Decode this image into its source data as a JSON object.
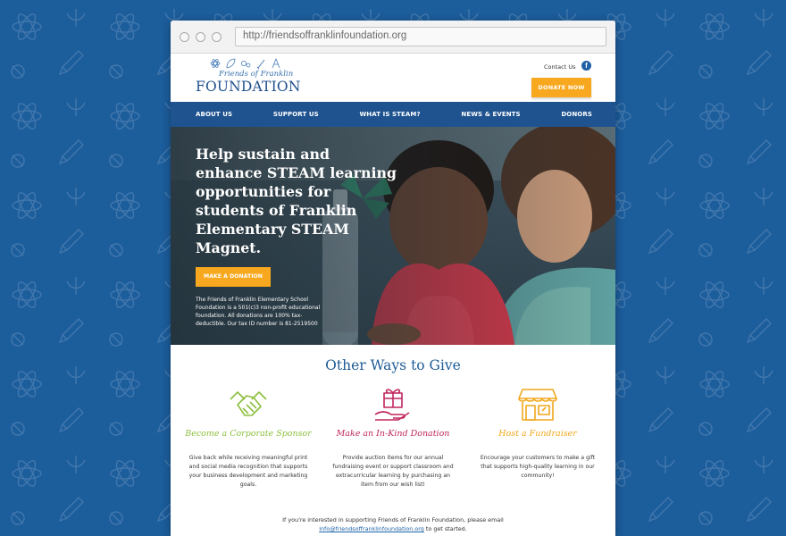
{
  "browser": {
    "url": "http://friendsoffranklinfoundation.org"
  },
  "logo": {
    "line1": "Friends of Franklin",
    "line2": "FOUNDATION"
  },
  "header": {
    "contact": "Contact Us",
    "facebook_glyph": "f",
    "donate": "DONATE NOW"
  },
  "nav": {
    "items": [
      "ABOUT US",
      "SUPPORT US",
      "WHAT IS STEAM?",
      "NEWS & EVENTS",
      "DONORS"
    ]
  },
  "hero": {
    "headline": "Help sustain and enhance STEAM learning opportunities for students of Franklin Elementary STEAM Magnet.",
    "button": "MAKE A DONATION",
    "text": "The Friends of Franklin Elementary School Foundation is a 501(c)3 non-profit educational foundation. All donations are 100% tax-deductible. Our tax ID number is 81-2519500"
  },
  "ways": {
    "title": "Other Ways to Give",
    "items": [
      {
        "title": "Become a Corporate Sponsor",
        "color": "#8dbf3f",
        "icon": "handshake-icon",
        "text": "Give back while receiving meaningful print and social media recognition that supports your business development and marketing goals."
      },
      {
        "title": "Make an In-Kind Donation",
        "color": "#c0265f",
        "icon": "gift-hand-icon",
        "text": "Provide auction items for our annual fundraising event or support classroom and extracurricular learning by purchasing an item from our wish list!"
      },
      {
        "title": "Host a Fundraiser",
        "color": "#f2a71c",
        "icon": "storefront-icon",
        "text": "Encourage your customers to make a gift that supports high-quality learning in our community!"
      }
    ]
  },
  "footer": {
    "text": "If you're interested in supporting Friends of Franklin Foundation, please email",
    "email": "info@friendsoffranklinfoundation.org",
    "suffix": "to get started."
  },
  "colors": {
    "background": "#1c5d9c",
    "nav": "#1e5390",
    "accent": "#f7a81e",
    "title": "#1f5b96"
  }
}
